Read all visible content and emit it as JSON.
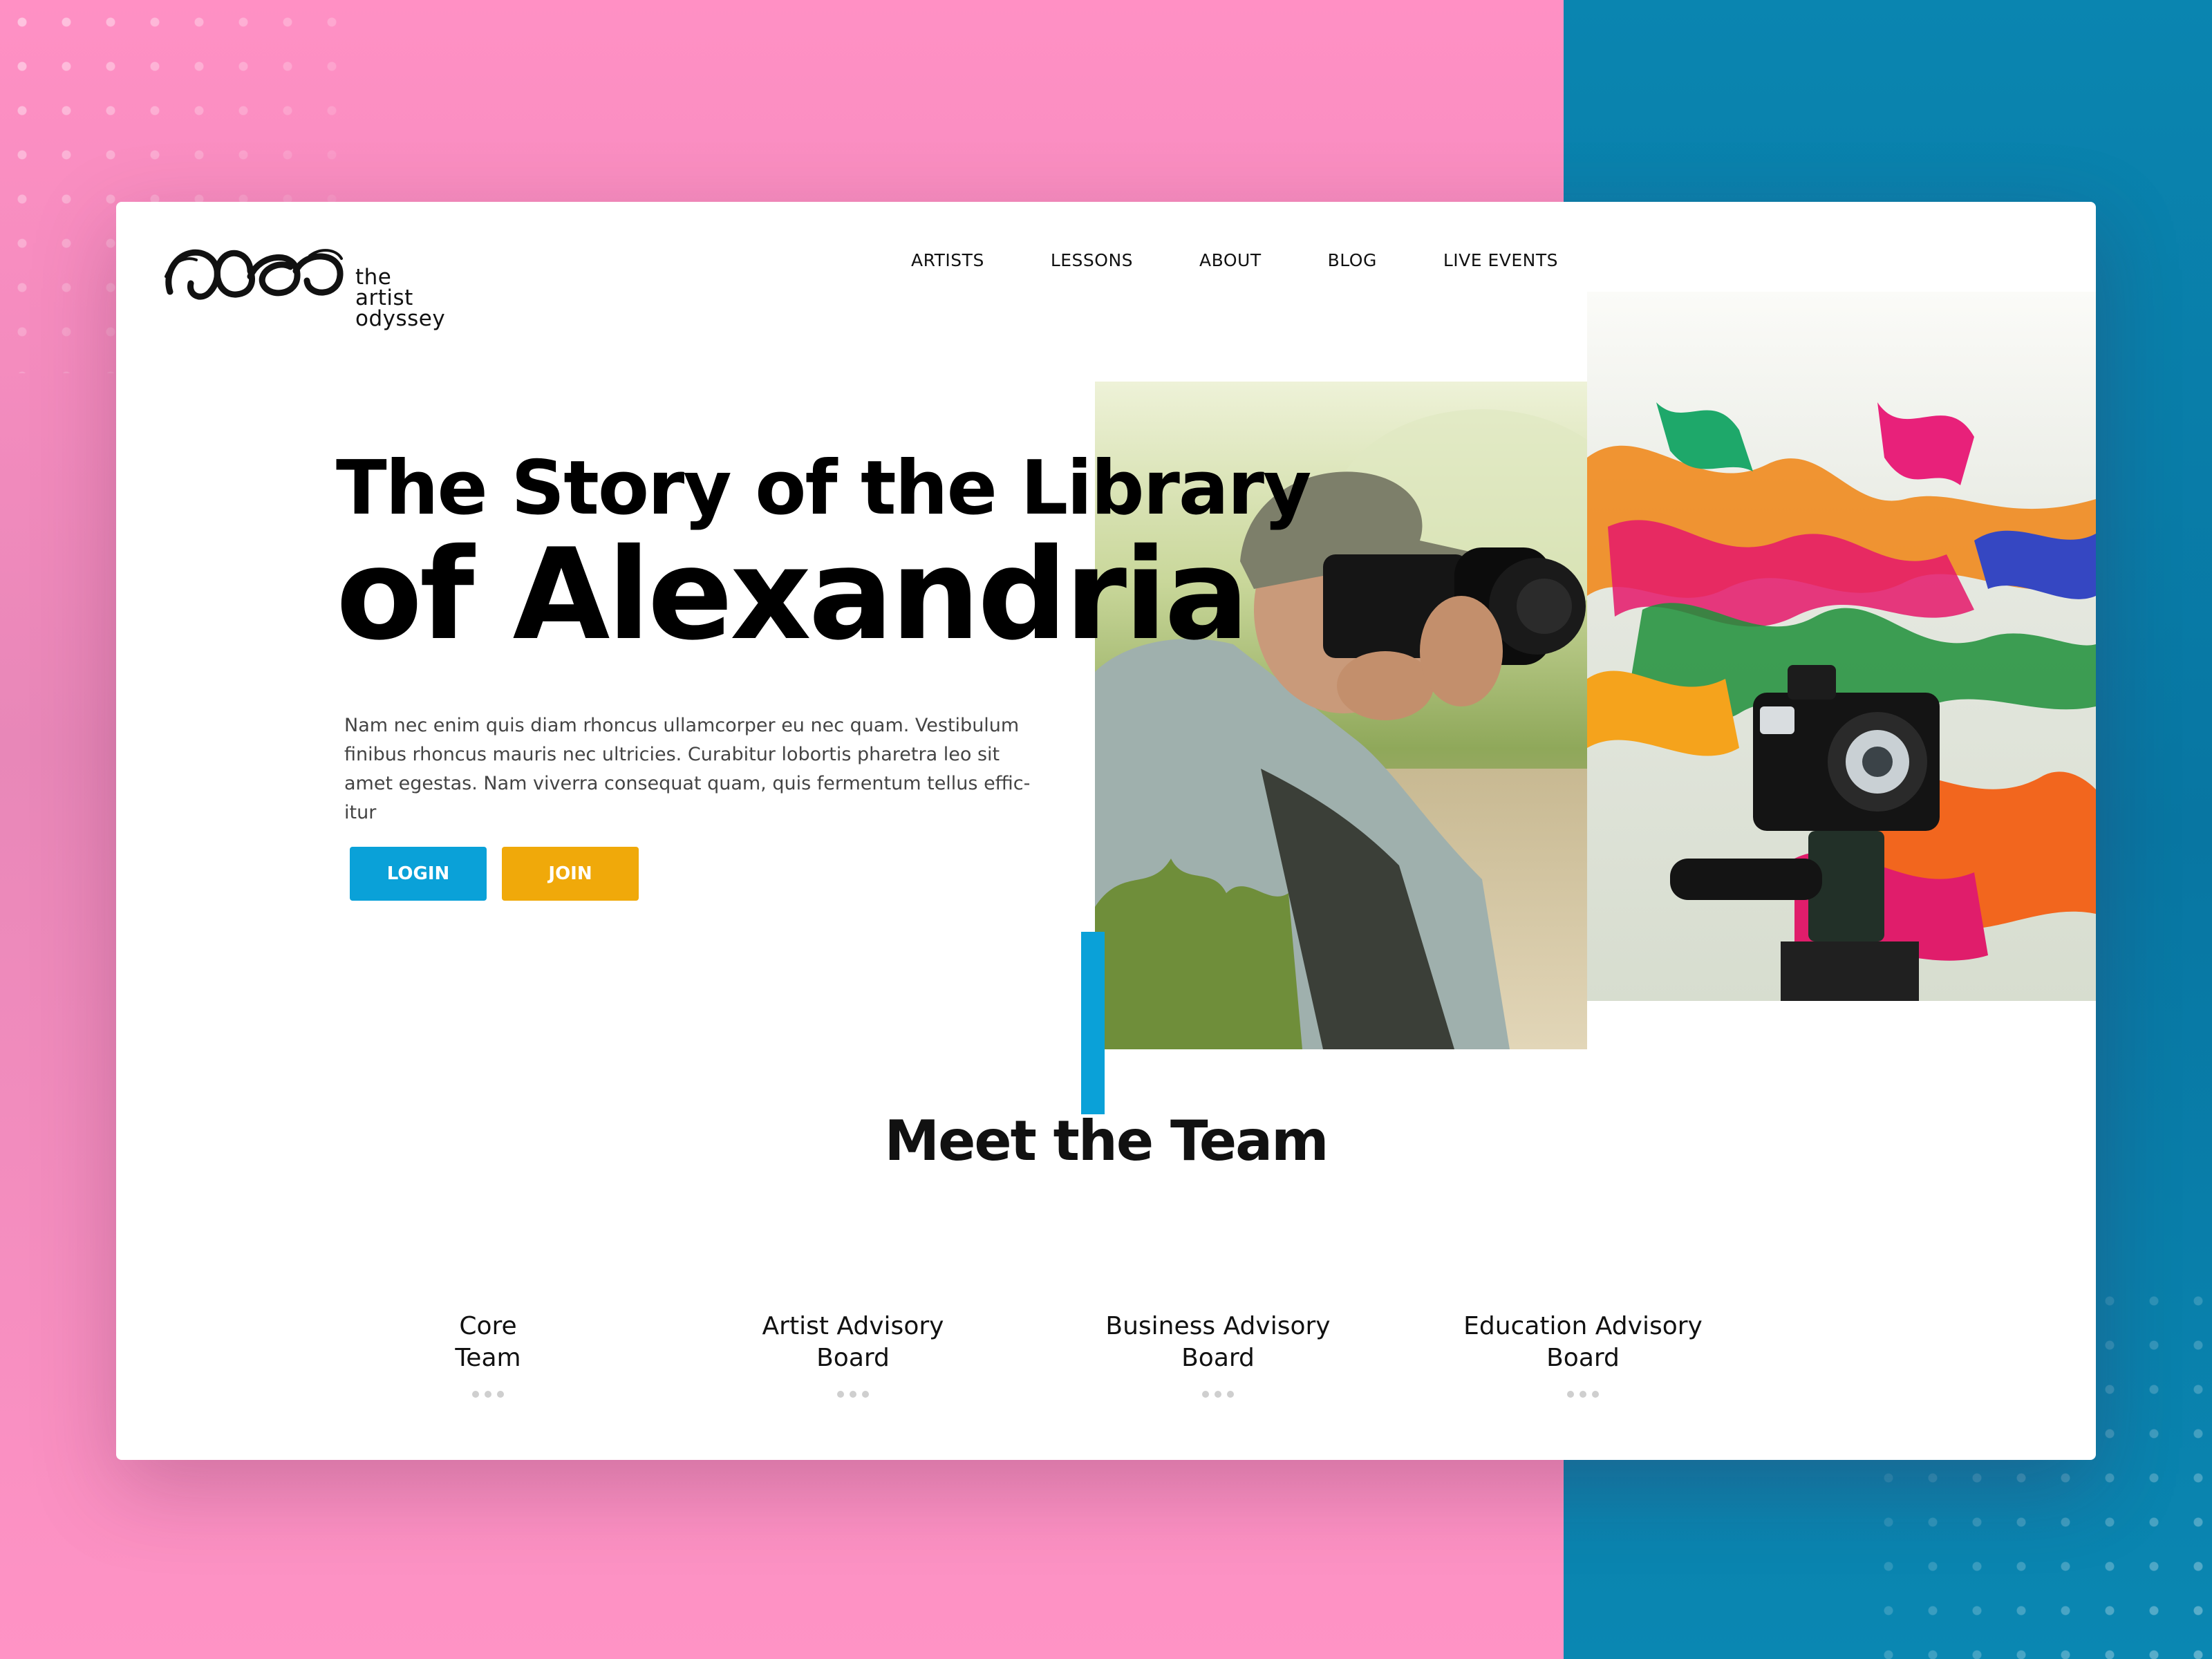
{
  "brand": {
    "logo_text_line1": "the",
    "logo_text_line2": "artist",
    "logo_text_line3": "odyssey"
  },
  "nav": {
    "items": [
      {
        "label": "ARTISTS"
      },
      {
        "label": "LESSONS"
      },
      {
        "label": "ABOUT"
      },
      {
        "label": "BLOG"
      },
      {
        "label": "LIVE EVENTS"
      }
    ]
  },
  "hero": {
    "title_line1": "The Story of the Library",
    "title_line2": "of Alexandria",
    "description": "Nam nec enim quis diam rhoncus ullamcorper eu nec quam. Vestibulum finibus rhoncus mauris nec ultricies. Curabitur lobortis pharetra leo sit amet egestas. Nam viverra consequat quam, quis fermentum tellus effic-itur",
    "login_label": "LOGIN",
    "join_label": "JOIN"
  },
  "team": {
    "heading": "Meet the Team",
    "groups": [
      {
        "label": "Core\nTeam"
      },
      {
        "label": "Artist  Advisory\nBoard"
      },
      {
        "label": "Business Advisory\nBoard"
      },
      {
        "label": "Education Advisory\nBoard"
      }
    ]
  },
  "colors": {
    "background_pink": "#ff90c4",
    "background_blue": "#0a85b0",
    "accent_blue": "#0aa1d8",
    "accent_yellow": "#f0a90a"
  },
  "icons": {
    "logo": "brush-circles-logo",
    "more": "three-dots-icon"
  }
}
